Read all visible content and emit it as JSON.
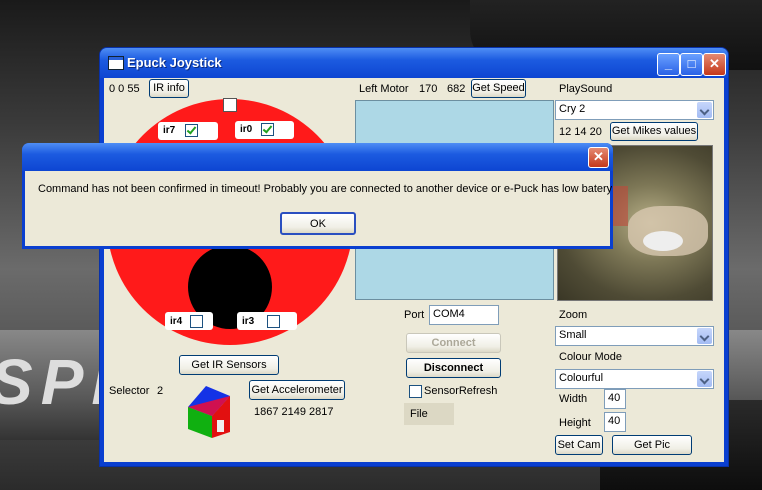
{
  "window": {
    "title": "Epuck Joystick"
  },
  "top": {
    "ir_values": "0 0 55",
    "ir_info": "IR info",
    "left_motor_label": "Left Motor",
    "left_motor_v1": "170",
    "left_motor_v2": "682",
    "get_speed": "Get Speed"
  },
  "ir": {
    "ir7": {
      "label": "ir7",
      "checked": true
    },
    "ir0": {
      "label": "ir0",
      "checked": true
    },
    "ir4": {
      "label": "ir4",
      "checked": false
    },
    "ir3": {
      "label": "ir3",
      "checked": false
    },
    "get_ir": "Get IR Sensors"
  },
  "selector": {
    "label": "Selector",
    "value": "2"
  },
  "accel": {
    "button": "Get Accelerometer",
    "values": "1867 2149 2817"
  },
  "conn": {
    "port_label": "Port",
    "port_value": "COM4",
    "connect": "Connect",
    "disconnect": "Disconnect",
    "sensor_refresh": "SensorRefresh",
    "file": "File"
  },
  "sound": {
    "label": "PlaySound",
    "selected": "Cry 2",
    "mikes": "12 14 20",
    "get_mikes": "Get Mikes values"
  },
  "cam": {
    "zoom_label": "Zoom",
    "zoom_value": "Small",
    "colour_label": "Colour Mode",
    "colour_value": "Colourful",
    "width_label": "Width",
    "width_value": "40",
    "height_label": "Height",
    "height_value": "40",
    "set_cam": "Set Cam",
    "get_pic": "Get Pic"
  },
  "dialog": {
    "message": "Command has not been confirmed in timeout! Probably you are connected to another device or e-Puck has low batery",
    "ok": "OK"
  },
  "colors": {
    "titlebar": "#1c5be0",
    "ring": "#ff1a1a",
    "motor_panel": "#add8e6"
  }
}
